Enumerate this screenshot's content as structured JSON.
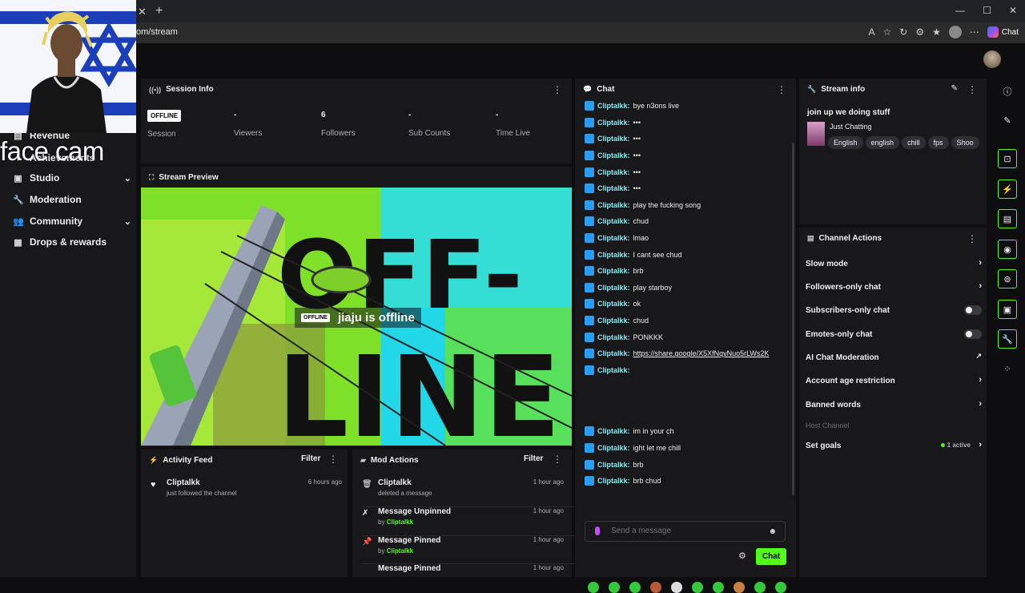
{
  "browser": {
    "url": "om/stream",
    "tab_close": "✕",
    "tab_new": "+",
    "chat_label": "Chat",
    "win_min": "—",
    "win_max": "☐",
    "win_close": "✕",
    "top_right": "96"
  },
  "overlay": {
    "facecam_label": "face cam"
  },
  "sidebar": {
    "items": [
      {
        "label": "Revenue",
        "icon": "chart-icon"
      },
      {
        "label": "Achievements",
        "icon": "trophy-icon"
      },
      {
        "label": "Studio",
        "icon": "studio-icon"
      },
      {
        "label": "Moderation",
        "icon": "wrench-icon"
      },
      {
        "label": "Community",
        "icon": "users-icon"
      },
      {
        "label": "Drops & rewards",
        "icon": "gift-icon"
      }
    ]
  },
  "session": {
    "title": "Session Info",
    "status_badge": "OFFLINE",
    "stats": [
      {
        "value": "",
        "label": "Session"
      },
      {
        "value": "-",
        "label": "Viewers"
      },
      {
        "value": "6",
        "label": "Followers"
      },
      {
        "value": "-",
        "label": "Sub Counts"
      },
      {
        "value": "-",
        "label": "Time Live"
      }
    ]
  },
  "preview": {
    "title": "Stream Preview",
    "badge": "OFFLINE",
    "text": "jiaju is offline",
    "art_top": "OFF-",
    "art_bottom": "LINE"
  },
  "activity": {
    "title": "Activity Feed",
    "filter": "Filter",
    "items": [
      {
        "name": "Cliptalkk",
        "sub": "just followed the channel",
        "time": "6 hours ago"
      }
    ]
  },
  "mod": {
    "title": "Mod Actions",
    "filter": "Filter",
    "items": [
      {
        "name": "Cliptalkk",
        "sub": "deleted a message",
        "by": "",
        "time": "1 hour ago",
        "icon": "trash-icon"
      },
      {
        "name": "Message Unpinned",
        "sub": "by",
        "by": "Cliptalkk",
        "time": "1 hour ago",
        "icon": "unpin-icon"
      },
      {
        "name": "Message Pinned",
        "sub": "by",
        "by": "Cliptalkk",
        "time": "1 hour ago",
        "icon": "pin-icon"
      },
      {
        "name": "Message Pinned",
        "sub": "",
        "by": "",
        "time": "1 hour ago",
        "icon": "pin-icon"
      }
    ]
  },
  "chat": {
    "title": "Chat",
    "user": "Cliptalkk",
    "messages": [
      "bye n3ons live",
      "•••",
      "•••",
      "•••",
      "•••",
      "•••",
      "play the fucking song",
      "chud",
      "lmao",
      "I cant see chud",
      "brb",
      "play starboy",
      "ok",
      "chud",
      "PONKKK",
      "https://share.google/X5XfNqyNuo5rLWs2K",
      ""
    ],
    "messages_after": [
      "im in your ch",
      "ight let me chill",
      "brb",
      "brb chud"
    ],
    "input_placeholder": "Send a message",
    "send_button": "Chat"
  },
  "stream_info": {
    "title": "Stream info",
    "stream_title": "join up we doing stuff",
    "category": "Just Chatting",
    "tags": [
      "English",
      "english",
      "chill",
      "fps",
      "Shoo"
    ]
  },
  "channel_actions": {
    "title": "Channel Actions",
    "items": [
      {
        "label": "Slow mode",
        "control": "chevron"
      },
      {
        "label": "Followers-only chat",
        "control": "chevron"
      },
      {
        "label": "Subscribers-only chat",
        "control": "toggle"
      },
      {
        "label": "Emotes-only chat",
        "control": "toggle"
      },
      {
        "label": "AI Chat Moderation",
        "control": "external"
      },
      {
        "label": "Account age restriction",
        "control": "chevron"
      },
      {
        "label": "Banned words",
        "control": "chevron"
      },
      {
        "label": "Host Channel",
        "control": "none"
      },
      {
        "label": "Set goals",
        "control": "chevron"
      }
    ],
    "goals_active": "1 active"
  },
  "colors": {
    "accent": "#53fc18",
    "panel": "#18181b",
    "bg": "#0e0e10",
    "username": "#8be8f0"
  }
}
